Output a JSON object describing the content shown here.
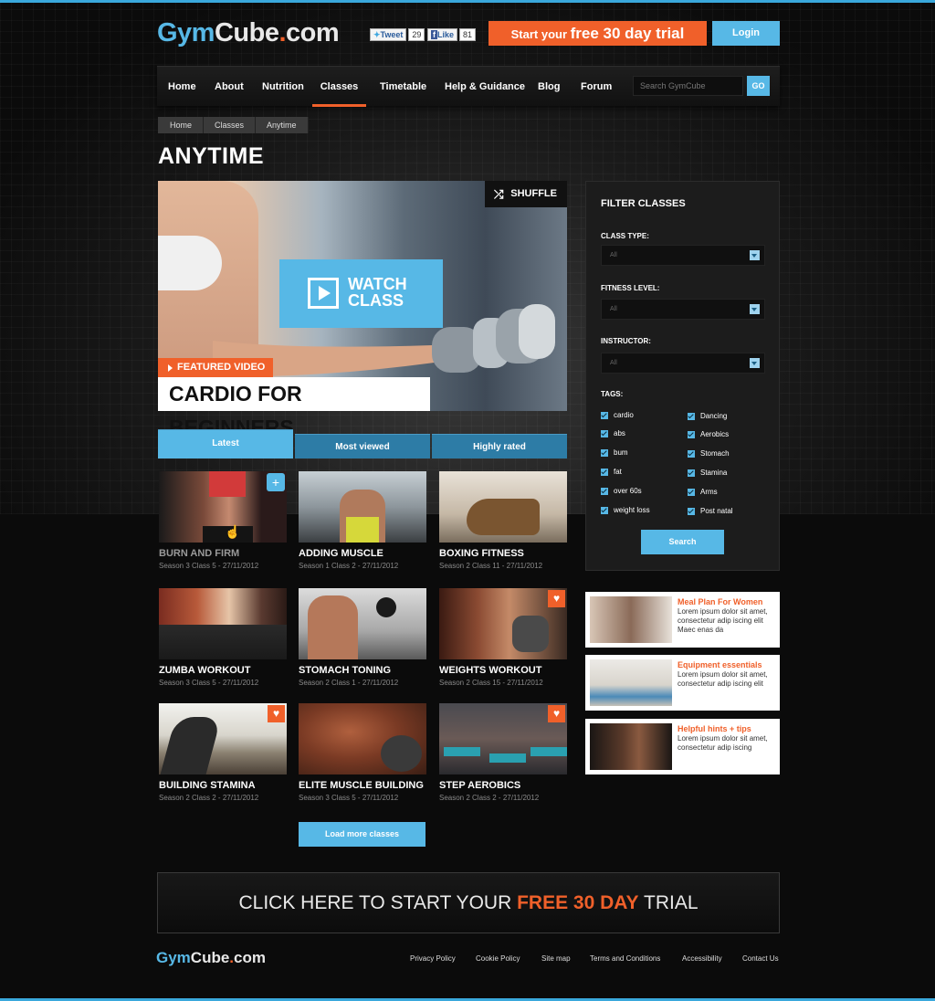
{
  "header": {
    "logo": {
      "part1": "Gym",
      "part2": "Cube",
      "part3": ".",
      "part4": "com"
    },
    "tweet_label": "Tweet",
    "tweet_count": "29",
    "like_label": "Like",
    "like_count": "81",
    "trial": {
      "pre": "Start your ",
      "big": "free 30 day trial"
    },
    "login_label": "Login"
  },
  "nav": {
    "items": [
      "Home",
      "About",
      "Nutrition",
      "Classes",
      "Timetable",
      "Help & Guidance",
      "Blog",
      "Forum"
    ],
    "active": "Classes",
    "search_placeholder": "Search GymCube",
    "go_label": "GO"
  },
  "breadcrumb": [
    "Home",
    "Classes",
    "Anytime"
  ],
  "page_title": "ANYTIME",
  "featured": {
    "shuffle_label": "SHUFFLE",
    "watch_label_1": "WATCH",
    "watch_label_2": "CLASS",
    "tag": "FEATURED VIDEO",
    "title": "CARDIO FOR BEGINNERS"
  },
  "tabs": [
    "Latest",
    "Most viewed",
    "Highly rated"
  ],
  "classes": [
    {
      "title": "BURN AND FIRM",
      "meta": "Season 3 Class 5 - 27/11/2012"
    },
    {
      "title": "ADDING MUSCLE",
      "meta": "Season 1 Class 2 - 27/11/2012"
    },
    {
      "title": "BOXING FITNESS",
      "meta": "Season 2 Class 11 - 27/11/2012"
    },
    {
      "title": "ZUMBA WORKOUT",
      "meta": "Season 3 Class 5 - 27/11/2012"
    },
    {
      "title": "STOMACH TONING",
      "meta": "Season 2 Class 1 - 27/11/2012"
    },
    {
      "title": "WEIGHTS WORKOUT",
      "meta": "Season 2 Class 15 - 27/11/2012"
    },
    {
      "title": "BUILDING STAMINA",
      "meta": "Season 2 Class 2 - 27/11/2012"
    },
    {
      "title": "ELITE MUSCLE BUILDING",
      "meta": "Season 3 Class 5 - 27/11/2012"
    },
    {
      "title": "STEP AEROBICS",
      "meta": "Season 2 Class 2 - 27/11/2012"
    }
  ],
  "load_more_label": "Load more classes",
  "filter": {
    "title": "FILTER CLASSES",
    "class_type_label": "CLASS TYPE:",
    "class_type_value": "All",
    "fitness_label": "FITNESS LEVEL:",
    "fitness_value": "All",
    "instructor_label": "INSTRUCTOR:",
    "instructor_value": "All",
    "tags_label": "TAGS:",
    "tags_left": [
      "cardio",
      "abs",
      "bum",
      "fat",
      "over 60s",
      "weight loss"
    ],
    "tags_right": [
      "Dancing",
      "Aerobics",
      "Stomach",
      "Stamina",
      "Arms",
      "Post natal"
    ],
    "search_label": "Search"
  },
  "promos": [
    {
      "title": "Meal Plan For Women",
      "text": "Lorem ipsum dolor sit amet, consectetur adip iscing elit Maec enas da"
    },
    {
      "title": "Equipment essentials",
      "text": "Lorem ipsum dolor sit amet, consectetur adip iscing elit"
    },
    {
      "title": "Helpful hints + tips",
      "text": "Lorem ipsum dolor sit amet, consectetur adip iscing"
    }
  ],
  "cta": {
    "pre": "CLICK HERE TO START YOUR ",
    "hl": "FREE 30 DAY",
    "post": " TRIAL"
  },
  "footer": {
    "logo": {
      "part1": "Gym",
      "part2": "Cube",
      "part3": ".",
      "part4": "com"
    },
    "links": [
      "Privacy Policy",
      "Cookie Policy",
      "Site map",
      "Terms and Conditions",
      "Accessibility",
      "Contact Us"
    ]
  },
  "colors": {
    "accent_blue": "#57b8e6",
    "accent_orange": "#f0602a",
    "background": "#0b0b0b"
  }
}
